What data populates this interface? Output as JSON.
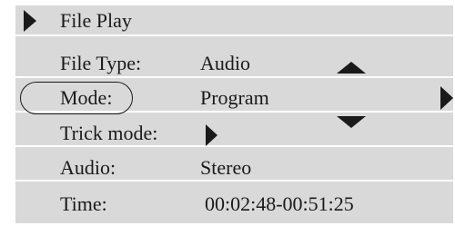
{
  "menu": {
    "title": "File Play",
    "items": [
      {
        "label": "File Type:",
        "value": "Audio"
      },
      {
        "label": "Mode:",
        "value": "Program"
      },
      {
        "label": "Trick mode:",
        "value": ""
      },
      {
        "label": "Audio:",
        "value": "Stereo"
      },
      {
        "label": "Time:",
        "value": "00:02:48-00:51:25"
      }
    ]
  },
  "icons": {
    "title_marker": "play-triangle-icon",
    "scroll_up": "triangle-up-icon",
    "scroll_down": "triangle-down-icon",
    "next_value": "triangle-right-icon",
    "trick_submenu": "triangle-right-icon"
  },
  "colors": {
    "background": "#ffffff",
    "row": "#d9d9d9",
    "separator": "#ffffff",
    "foreground": "#1a1a1a"
  }
}
